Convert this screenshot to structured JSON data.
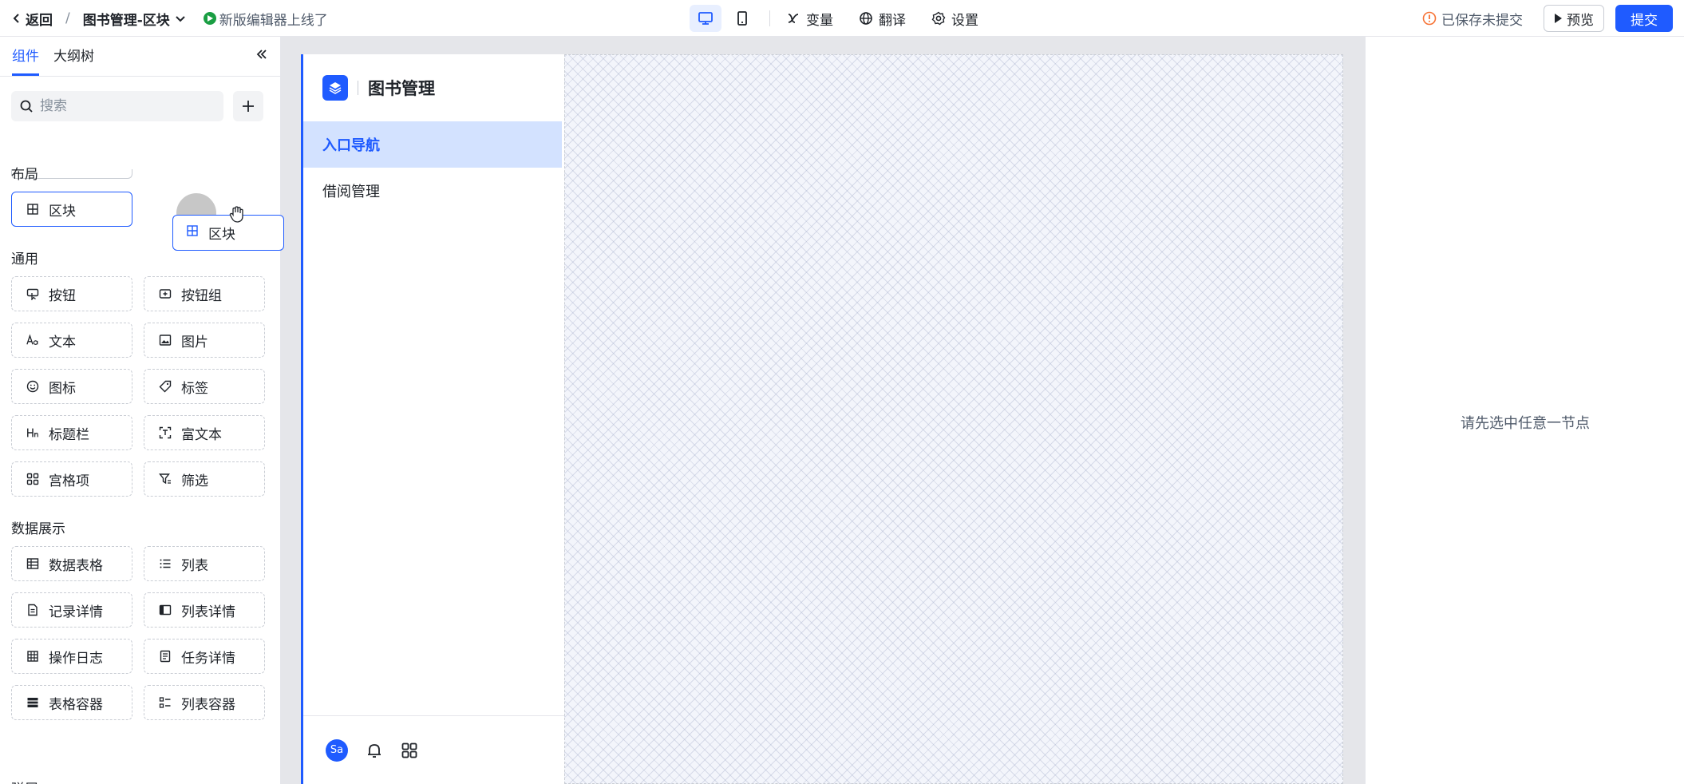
{
  "topbar": {
    "back_label": "返回",
    "separator": "/",
    "page_name": "图书管理-区块",
    "news": "新版编辑器上线了",
    "tools": [
      {
        "label": "变量",
        "icon": "variable-icon"
      },
      {
        "label": "翻译",
        "icon": "globe-icon"
      },
      {
        "label": "设置",
        "icon": "gear-icon"
      }
    ],
    "save_status": "已保存未提交",
    "preview_label": "预览",
    "submit_label": "提交"
  },
  "left_panel": {
    "tabs": [
      "组件",
      "大纲树"
    ],
    "search_placeholder": "搜索",
    "sections": [
      {
        "title": "布局",
        "items": [
          "区块"
        ]
      },
      {
        "title": "通用",
        "items": [
          "按钮",
          "按钮组",
          "文本",
          "图片",
          "图标",
          "标签",
          "标题栏",
          "富文本",
          "宫格项",
          "筛选"
        ]
      },
      {
        "title": "数据展示",
        "items": [
          "数据表格",
          "列表",
          "记录详情",
          "列表详情",
          "操作日志",
          "任务详情",
          "表格容器",
          "列表容器"
        ]
      },
      {
        "title": "弹层",
        "items": []
      }
    ]
  },
  "drag": {
    "label": "区块"
  },
  "app": {
    "title": "图书管理",
    "nav": [
      "入口导航",
      "借阅管理"
    ],
    "avatar": "Sa"
  },
  "right_panel": {
    "empty_tip": "请先选中任意一节点"
  },
  "colors": {
    "accent": "#1f5bff",
    "nav_active_bg": "#d3e2ff",
    "news_dot": "#1a9e43",
    "warning": "#f77234"
  }
}
